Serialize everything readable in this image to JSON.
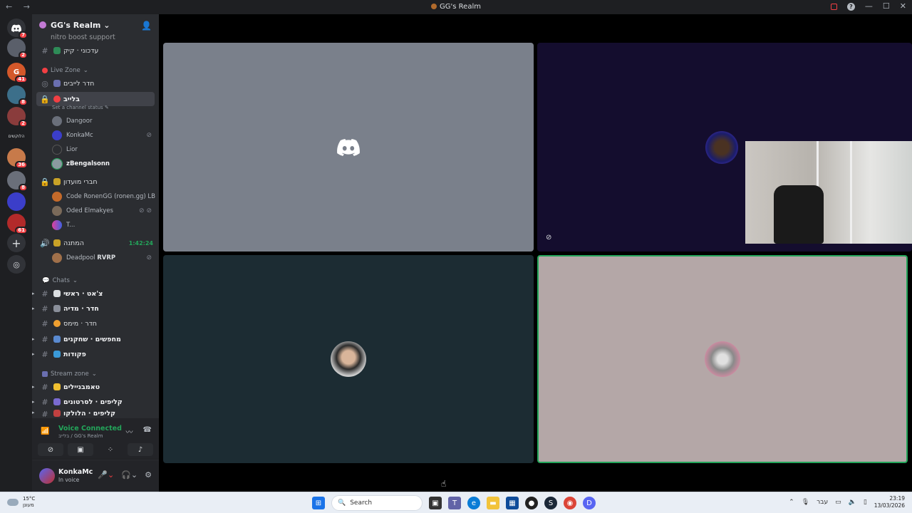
{
  "window": {
    "title": "GG's Realm"
  },
  "server_rail": {
    "badges": [
      "7",
      "2",
      "41",
      "8",
      "2",
      "36",
      "8",
      "61"
    ],
    "text_server": "הלוקשים"
  },
  "guild": {
    "name": "GG's Realm"
  },
  "channels": {
    "partial_top": "nitro boost support",
    "updates": "עדכוני · קיק",
    "live_zone_category": "Live Zone",
    "streams_room": "חדר לייבים",
    "live_channel": "בלייב",
    "channel_status_placeholder": "Set a channel status",
    "live_users": [
      "Dangoor",
      "KonkaMc",
      "Lior",
      "zBengalsonn"
    ],
    "club_channel": "חברי מועדון",
    "club_users": [
      "Code RonenGG (ronen.gg) LB",
      "Oded Elmakyes",
      "T..."
    ],
    "gift_channel": "המתנה",
    "gift_timer": "1:42:24",
    "gift_user": "Deadpool",
    "gift_user_tag": "RVRP",
    "chats_category": "Chats",
    "chat_channels": [
      "צ'אט · ראשי",
      "חדר · מדיה",
      "חדר · מימס",
      "מחפשים · שחקנים",
      "פקודות"
    ],
    "stream_category": "Stream zone",
    "stream_channels": [
      "טאמבניילים",
      "קליפים · לסרטונים",
      "קליפים · הלולקו"
    ]
  },
  "voice_panel": {
    "title": "Voice Connected",
    "subtitle": "בלייב / GG's Realm"
  },
  "user_panel": {
    "name": "KonkaMc",
    "status": "In voice"
  },
  "taskbar": {
    "weather_temp": "15°C",
    "weather_desc": "מעונן",
    "search_placeholder": "Search",
    "lang": "עבר",
    "time": "23:19",
    "date": "13/03/2026"
  },
  "colors": {
    "online_green": "#23a55a",
    "danger_red": "#f23f43",
    "blurple": "#5865f2"
  }
}
